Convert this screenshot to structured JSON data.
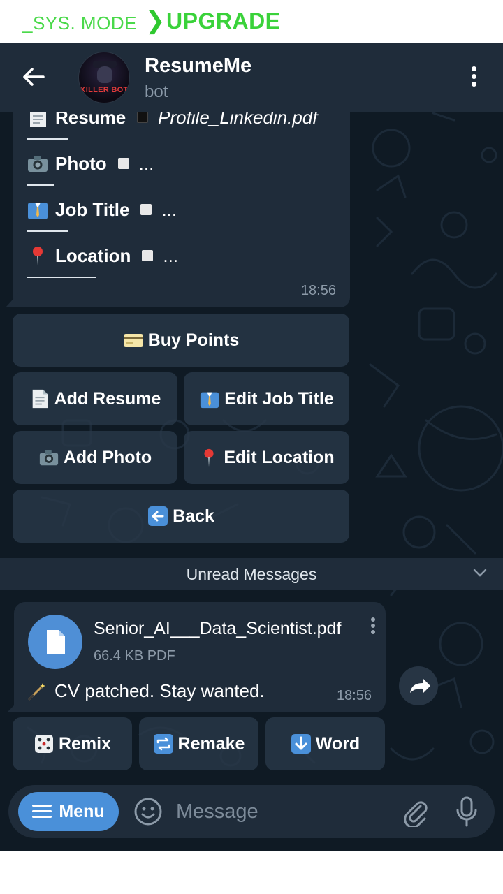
{
  "banner": {
    "sys_mode": "_SYS. MODE",
    "chevron": "❯",
    "upgrade": "UPGRADE"
  },
  "header": {
    "title": "ResumeMe",
    "subtitle": "bot",
    "avatar_text": "KILLER BOT"
  },
  "profile_message": {
    "rows": [
      {
        "icon": "page-icon",
        "label": "Resume",
        "value": "Profile_Linkedin.pdf"
      },
      {
        "icon": "camera-icon",
        "label": "Photo",
        "value": "..."
      },
      {
        "icon": "office-worker-icon",
        "label": "Job Title",
        "value": "..."
      },
      {
        "icon": "pin-icon",
        "label": "Location",
        "value": "..."
      }
    ],
    "time": "18:56"
  },
  "keyboard": {
    "buy_points": "Buy Points",
    "add_resume": "Add Resume",
    "edit_job_title": "Edit Job Title",
    "add_photo": "Add Photo",
    "edit_location": "Edit Location",
    "back": "Back"
  },
  "unread_label": "Unread Messages",
  "file_message": {
    "file_name": "Senior_AI___Data_Scientist.pdf",
    "file_meta": "66.4 KB PDF",
    "caption": "CV patched. Stay wanted.",
    "time": "18:56"
  },
  "inline_buttons": {
    "remix": "Remix",
    "remake": "Remake",
    "word": "Word"
  },
  "input_bar": {
    "menu_label": "Menu",
    "placeholder": "Message"
  },
  "colors": {
    "accent": "#4a90d9",
    "header_bg": "#1f2c3a",
    "chat_bg": "#0f1a24",
    "banner_green": "#3ad23a"
  }
}
